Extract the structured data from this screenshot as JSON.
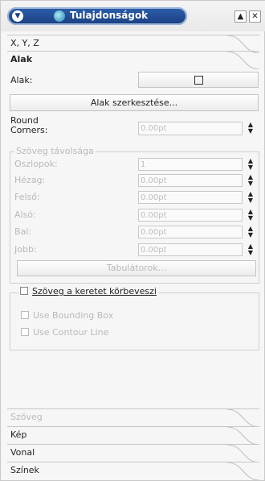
{
  "window": {
    "title": "Tulajdonságok",
    "menu_arrow_icon": "chevron-down-icon",
    "shade_btn": "▲",
    "close_btn": "✕"
  },
  "sections_top": [
    {
      "label": "X, Y, Z"
    },
    {
      "label": "Alak"
    }
  ],
  "alak": {
    "shape_label": "Alak:",
    "edit_button": "Alak szerkesztése...",
    "round_corners_label_1": "Round",
    "round_corners_label_2": "Corners:",
    "round_corners_value": "0.00pt"
  },
  "text_distance": {
    "title": "Szöveg távolsága",
    "rows": [
      {
        "label": "Oszlopok:",
        "value": "1"
      },
      {
        "label": "Hézag:",
        "value": "0.00pt"
      },
      {
        "label": "Felső:",
        "value": "0.00pt"
      },
      {
        "label": "Alsó:",
        "value": "0.00pt"
      },
      {
        "label": "Bal:",
        "value": "0.00pt"
      },
      {
        "label": "Jobb:",
        "value": "0.00pt"
      }
    ],
    "tabs_button": "Tabulátorok..."
  },
  "text_flow": {
    "title": "Szöveg a keretet körbeveszi",
    "bounding_box": "Use Bounding Box",
    "contour_line": "Use Contour Line"
  },
  "sections_bottom": [
    {
      "label": "Szöveg"
    },
    {
      "label": "Kép"
    },
    {
      "label": "Vonal"
    },
    {
      "label": "Színek"
    }
  ],
  "colors": {
    "title_bg": "#2d5fad",
    "disabled_text": "#b9b9b9"
  }
}
